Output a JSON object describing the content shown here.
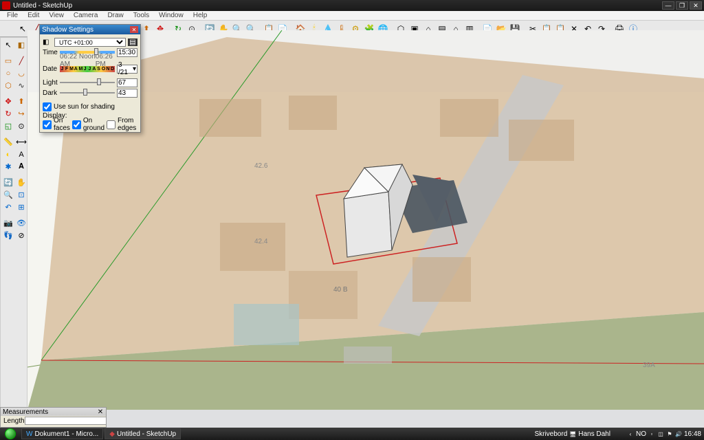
{
  "title": "Untitled - SketchUp",
  "menus": [
    "File",
    "Edit",
    "View",
    "Camera",
    "Draw",
    "Tools",
    "Window",
    "Help"
  ],
  "dialog": {
    "title": "Shadow Settings",
    "tz": "UTC +01:00",
    "time_label": "Time",
    "time_start": "06:22 AM",
    "time_noon": "Noon",
    "time_end": "06:26 PM",
    "time_value": "15:30",
    "date_label": "Date",
    "months": "JFMAMJJASOND",
    "date_value": "3 /21",
    "light_label": "Light",
    "light_value": "67",
    "dark_label": "Dark",
    "dark_value": "43",
    "use_sun": "Use sun for shading",
    "display_label": "Display:",
    "on_faces": "On faces",
    "on_ground": "On ground",
    "from_edges": "From edges"
  },
  "measurements": {
    "title": "Measurements",
    "length_label": "Length"
  },
  "taskbar": {
    "item1": "Dokument1 - Micro...",
    "item2": "Untitled - SketchUp",
    "desktop": "Skrivebord",
    "user": "Hans Dahl",
    "lang": "NO",
    "time": "16:48"
  }
}
